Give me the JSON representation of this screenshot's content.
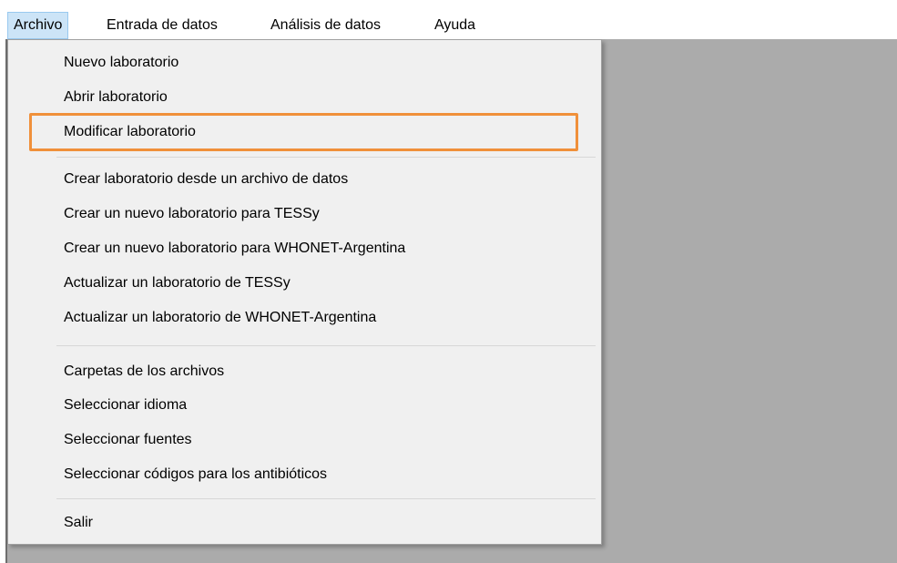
{
  "menubar": {
    "items": [
      {
        "label": "Archivo"
      },
      {
        "label": "Entrada de datos"
      },
      {
        "label": "Análisis de datos"
      },
      {
        "label": "Ayuda"
      }
    ]
  },
  "archivo_menu": {
    "items": [
      {
        "label": "Nuevo laboratorio"
      },
      {
        "label": "Abrir laboratorio"
      },
      {
        "label": "Modificar laboratorio"
      },
      {
        "label": "Crear laboratorio desde un archivo de datos"
      },
      {
        "label": "Crear un nuevo laboratorio para TESSy"
      },
      {
        "label": "Crear un nuevo laboratorio para WHONET-Argentina"
      },
      {
        "label": "Actualizar un laboratorio de TESSy"
      },
      {
        "label": "Actualizar un laboratorio de WHONET-Argentina"
      },
      {
        "label": "Carpetas de los archivos"
      },
      {
        "label": "Seleccionar idioma"
      },
      {
        "label": "Seleccionar fuentes"
      },
      {
        "label": "Seleccionar  códigos para los antibióticos"
      },
      {
        "label": "Salir"
      }
    ]
  },
  "colors": {
    "highlight_outline": "#f0903a",
    "menubar_active": "#cce4f7",
    "workspace": "#ababab"
  }
}
